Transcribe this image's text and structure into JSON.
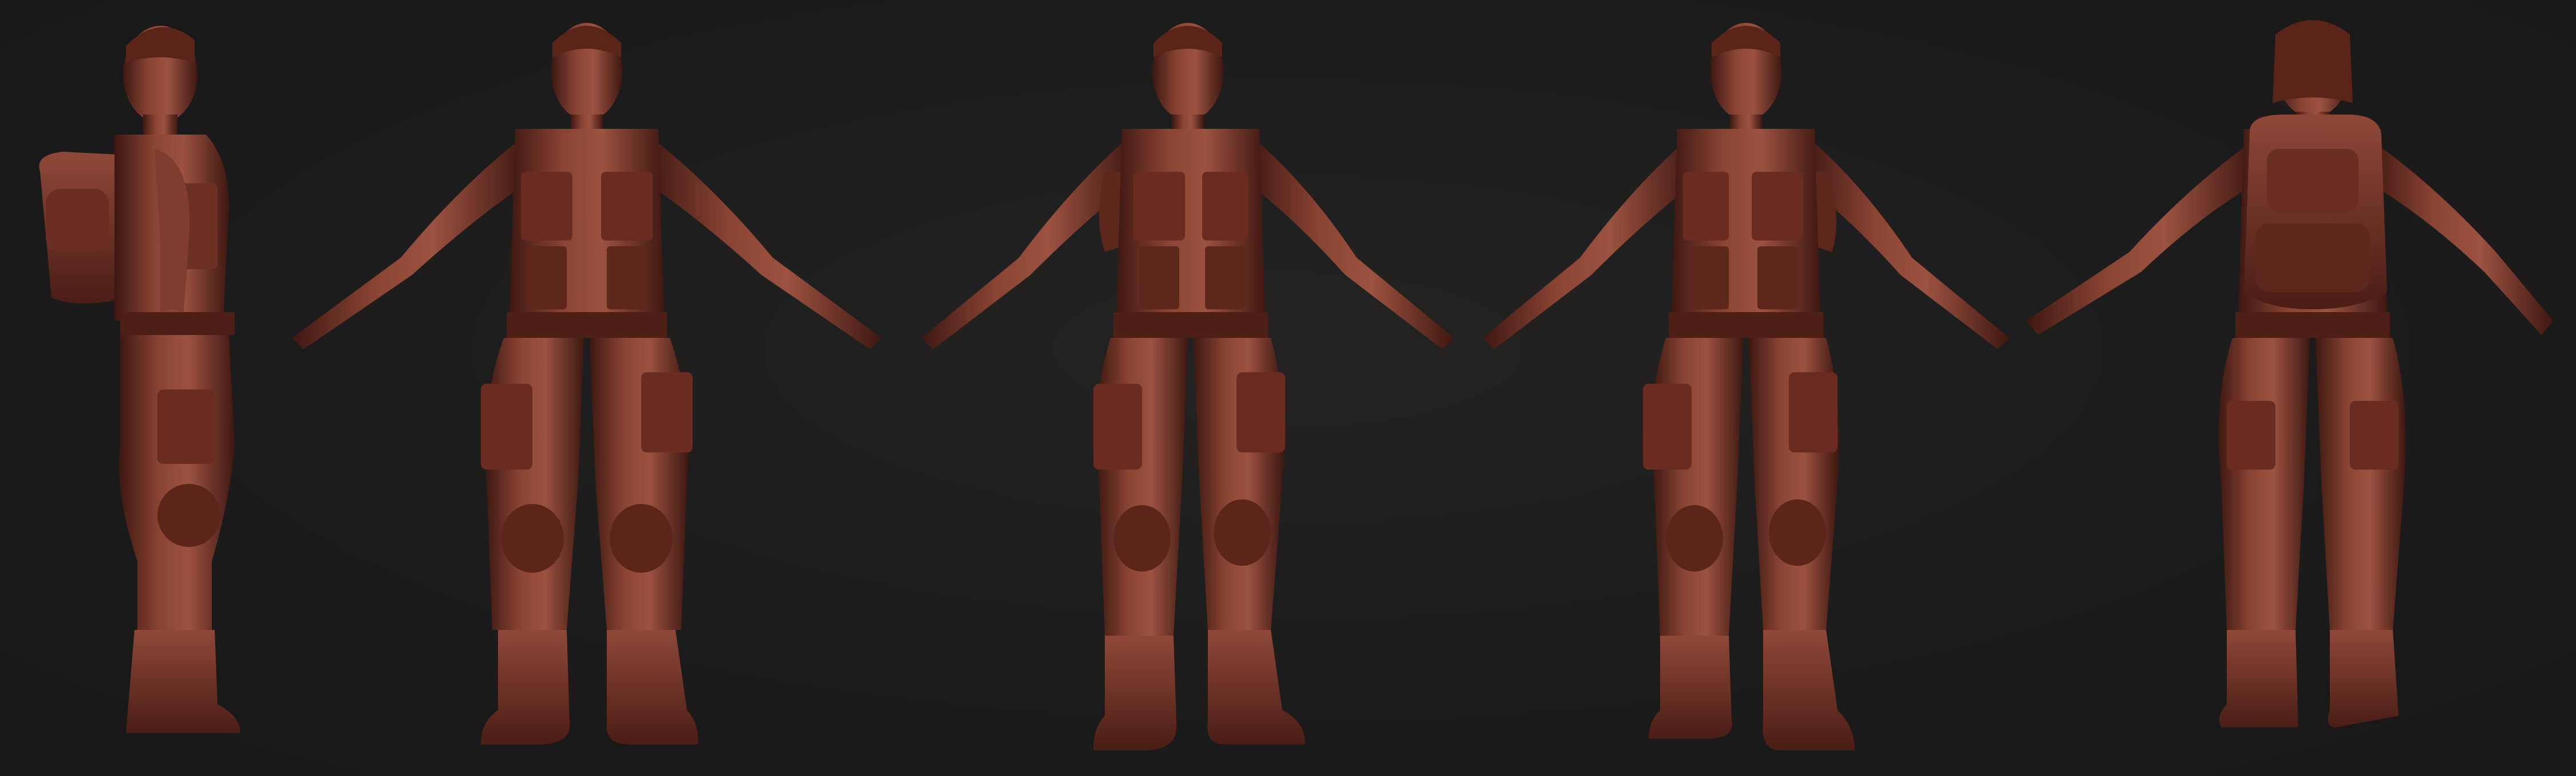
{
  "scene": {
    "subject": "sculpted-soldier-turnaround",
    "background_color": "#1d1c1c",
    "material_color": "#7a3a2c",
    "material_highlight": "#a35a45",
    "material_shadow": "#3e1812",
    "views": [
      {
        "id": "side",
        "icon": "figure-side-view"
      },
      {
        "id": "front",
        "icon": "figure-front-view"
      },
      {
        "id": "three-quarter-left",
        "icon": "figure-three-quarter-view"
      },
      {
        "id": "three-quarter-right",
        "icon": "figure-three-quarter-view"
      },
      {
        "id": "back",
        "icon": "figure-back-view"
      }
    ]
  }
}
